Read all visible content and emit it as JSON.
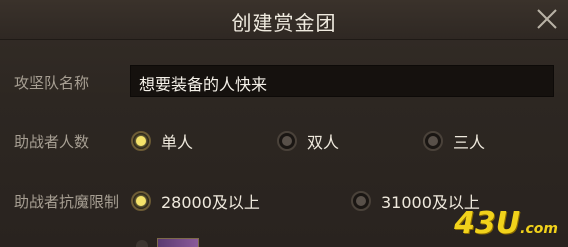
{
  "dialog": {
    "title": "创建赏金团",
    "close_icon": "close-icon"
  },
  "team_name": {
    "label": "攻坚队名称",
    "value": "想要装备的人快来"
  },
  "team_size": {
    "label": "助战者人数",
    "options": [
      {
        "label": "单人",
        "selected": true
      },
      {
        "label": "双人",
        "selected": false
      },
      {
        "label": "三人",
        "selected": false
      }
    ]
  },
  "resistance_limit": {
    "label": "助战者抗魔限制",
    "options": [
      {
        "label": "28000及以上",
        "selected": true
      },
      {
        "label": "31000及以上",
        "selected": false
      }
    ]
  },
  "watermark": {
    "main": "43U",
    "sub": ".com"
  },
  "colors": {
    "selected_radio": "#f5e36a",
    "background": "#2b2520",
    "watermark": "#f1d21b"
  }
}
